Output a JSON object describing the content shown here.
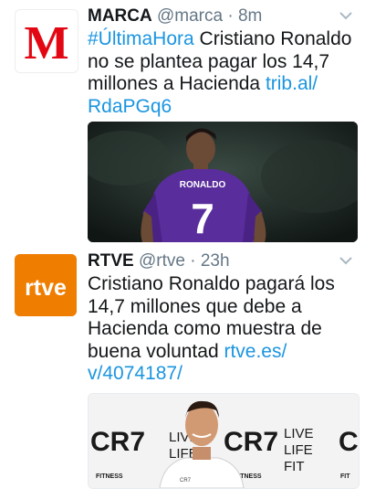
{
  "tweets": [
    {
      "account": "marca",
      "name": "MARCA",
      "handle": "@marca",
      "sep": "·",
      "time": "8m",
      "avatar_text": "M",
      "lines": [
        {
          "parts": [
            {
              "text": "#ÚltimaHora",
              "link": true
            },
            {
              "text": " Cristiano Ronaldo",
              "link": false
            }
          ]
        },
        {
          "parts": [
            {
              "text": "no se plantea pagar los 14,7",
              "link": false
            }
          ]
        },
        {
          "parts": [
            {
              "text": "millones a Hacienda ",
              "link": false
            },
            {
              "text": "trib.al/",
              "link": true
            }
          ]
        },
        {
          "parts": [
            {
              "text": "RdaPGq6",
              "link": true
            }
          ]
        }
      ],
      "media_jersey_name": "RONALDO",
      "media_jersey_number": "7"
    },
    {
      "account": "rtve",
      "name": "RTVE",
      "handle": "@rtve",
      "sep": "·",
      "time": "23h",
      "avatar_text": "rtve",
      "lines": [
        {
          "parts": [
            {
              "text": "Cristiano Ronaldo pagará los",
              "link": false
            }
          ]
        },
        {
          "parts": [
            {
              "text": "14,7 millones que debe a",
              "link": false
            }
          ]
        },
        {
          "parts": [
            {
              "text": "Hacienda como muestra de",
              "link": false
            }
          ]
        },
        {
          "parts": [
            {
              "text": "buena voluntad ",
              "link": false
            },
            {
              "text": "rtve.es/",
              "link": true
            }
          ]
        },
        {
          "parts": [
            {
              "text": "v/4074187/",
              "link": true
            }
          ]
        }
      ],
      "media_backdrop": [
        "CR7",
        "LIVE",
        "LIFE",
        "CR7",
        "LIVE",
        "LIFE",
        "FIT",
        "CR",
        "FITNESS",
        "FITNESS",
        "FIT"
      ]
    }
  ],
  "colors": {
    "link": "#1b95e0",
    "meta": "#657786",
    "marca_red": "#e30613",
    "rtve_orange": "#ef7d00"
  },
  "icons": [
    "chevron-down-icon"
  ]
}
